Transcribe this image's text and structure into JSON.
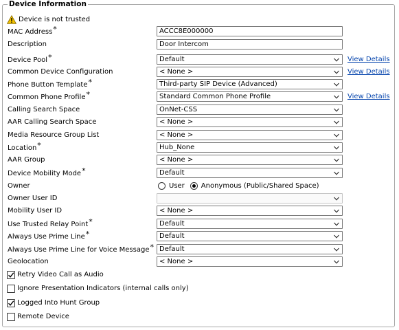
{
  "section": {
    "legend": "Device Information",
    "warning": "Device is not trusted"
  },
  "fields": [
    {
      "label": "MAC Address",
      "required": true,
      "type": "text",
      "value": "ACCC8E000000",
      "link": ""
    },
    {
      "label": "Description",
      "required": false,
      "type": "text",
      "value": "Door Intercom",
      "link": ""
    },
    {
      "label": "Device Pool",
      "required": true,
      "type": "select",
      "value": "Default",
      "link": "View Details"
    },
    {
      "label": "Common Device Configuration",
      "required": false,
      "type": "select",
      "value": "< None >",
      "link": "View Details"
    },
    {
      "label": "Phone Button Template",
      "required": true,
      "type": "select",
      "value": "Third-party SIP Device (Advanced)",
      "link": ""
    },
    {
      "label": "Common Phone Profile",
      "required": true,
      "type": "select",
      "value": "Standard Common Phone Profile",
      "link": "View Details"
    },
    {
      "label": "Calling Search Space",
      "required": false,
      "type": "select",
      "value": "OnNet-CSS",
      "link": ""
    },
    {
      "label": "AAR Calling Search Space",
      "required": false,
      "type": "select",
      "value": "< None >",
      "link": ""
    },
    {
      "label": "Media Resource Group List",
      "required": false,
      "type": "select",
      "value": "< None >",
      "link": ""
    },
    {
      "label": "Location",
      "required": true,
      "type": "select",
      "value": "Hub_None",
      "link": ""
    },
    {
      "label": "AAR Group",
      "required": false,
      "type": "select",
      "value": "< None >",
      "link": ""
    },
    {
      "label": "Device Mobility Mode",
      "required": true,
      "type": "select",
      "value": "Default",
      "link": ""
    },
    {
      "label": "Owner",
      "required": false,
      "type": "radio",
      "options": [
        "User",
        "Anonymous (Public/Shared Space)"
      ],
      "selected": "Anonymous (Public/Shared Space)"
    },
    {
      "label": "Owner User ID",
      "required": false,
      "type": "select",
      "value": "",
      "disabled": true,
      "link": ""
    },
    {
      "label": "Mobility User ID",
      "required": false,
      "type": "select",
      "value": "< None >",
      "link": ""
    },
    {
      "label": "Use Trusted Relay Point",
      "required": true,
      "type": "select",
      "value": "Default",
      "link": ""
    },
    {
      "label": "Always Use Prime Line",
      "required": true,
      "type": "select",
      "value": "Default",
      "link": ""
    },
    {
      "label": "Always Use Prime Line for Voice Message",
      "required": true,
      "type": "select",
      "value": "Default",
      "link": ""
    },
    {
      "label": "Geolocation",
      "required": false,
      "type": "select",
      "value": "< None >",
      "link": ""
    }
  ],
  "checkboxes": [
    {
      "label": "Retry Video Call as Audio",
      "checked": true
    },
    {
      "label": "Ignore Presentation Indicators (internal calls only)",
      "checked": false
    },
    {
      "label": "Logged Into Hunt Group",
      "checked": true
    },
    {
      "label": "Remote Device",
      "checked": false
    }
  ],
  "colors": {
    "link": "#0645ad",
    "warning": "#f2c200",
    "border": "#a8a8a8"
  },
  "icons": {
    "warning": "warning-triangle-icon",
    "dropdown": "chevron-down-icon",
    "checked": "checkmark-icon"
  }
}
